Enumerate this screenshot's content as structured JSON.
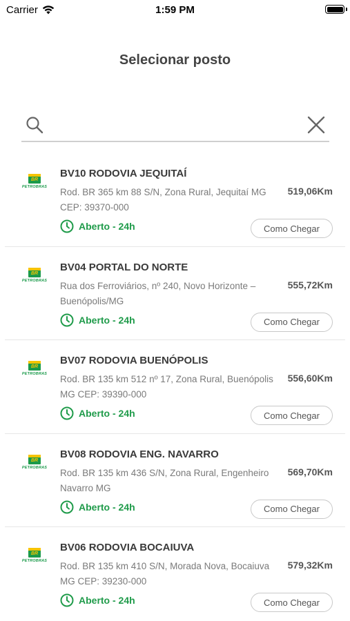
{
  "status_bar": {
    "carrier": "Carrier",
    "time": "1:59 PM"
  },
  "page": {
    "title": "Selecionar posto"
  },
  "search": {
    "value": "",
    "placeholder": ""
  },
  "brand": {
    "flag_text": "BR",
    "name": "PETROBRAS"
  },
  "colors": {
    "accent_green": "#1f9b4a",
    "logo_yellow": "#f6c400"
  },
  "stations": [
    {
      "name": "BV10 RODOVIA JEQUITAÍ",
      "address": "Rod. BR 365 km 88 S/N, Zona Rural, Jequitaí MG CEP: 39370-000",
      "distance": "519,06Km",
      "status": "Aberto - 24h",
      "button": "Como Chegar"
    },
    {
      "name": "BV04 PORTAL DO NORTE",
      "address": "Rua dos Ferroviários, nº 240, Novo Horizonte – Buenópolis/MG",
      "distance": "555,72Km",
      "status": "Aberto - 24h",
      "button": "Como Chegar"
    },
    {
      "name": "BV07 RODOVIA BUENÓPOLIS",
      "address": "Rod. BR 135 km 512 nº 17, Zona Rural, Buenópolis MG CEP: 39390-000",
      "distance": "556,60Km",
      "status": "Aberto - 24h",
      "button": "Como Chegar"
    },
    {
      "name": "BV08 RODOVIA ENG. NAVARRO",
      "address": "Rod. BR 135 km 436 S/N, Zona Rural, Engenheiro Navarro MG",
      "distance": "569,70Km",
      "status": "Aberto - 24h",
      "button": "Como Chegar"
    },
    {
      "name": "BV06 RODOVIA BOCAIUVA",
      "address": "Rod. BR 135 km 410 S/N, Morada Nova, Bocaiuva MG CEP: 39230-000",
      "distance": "579,32Km",
      "status": "Aberto - 24h",
      "button": "Como Chegar"
    }
  ]
}
